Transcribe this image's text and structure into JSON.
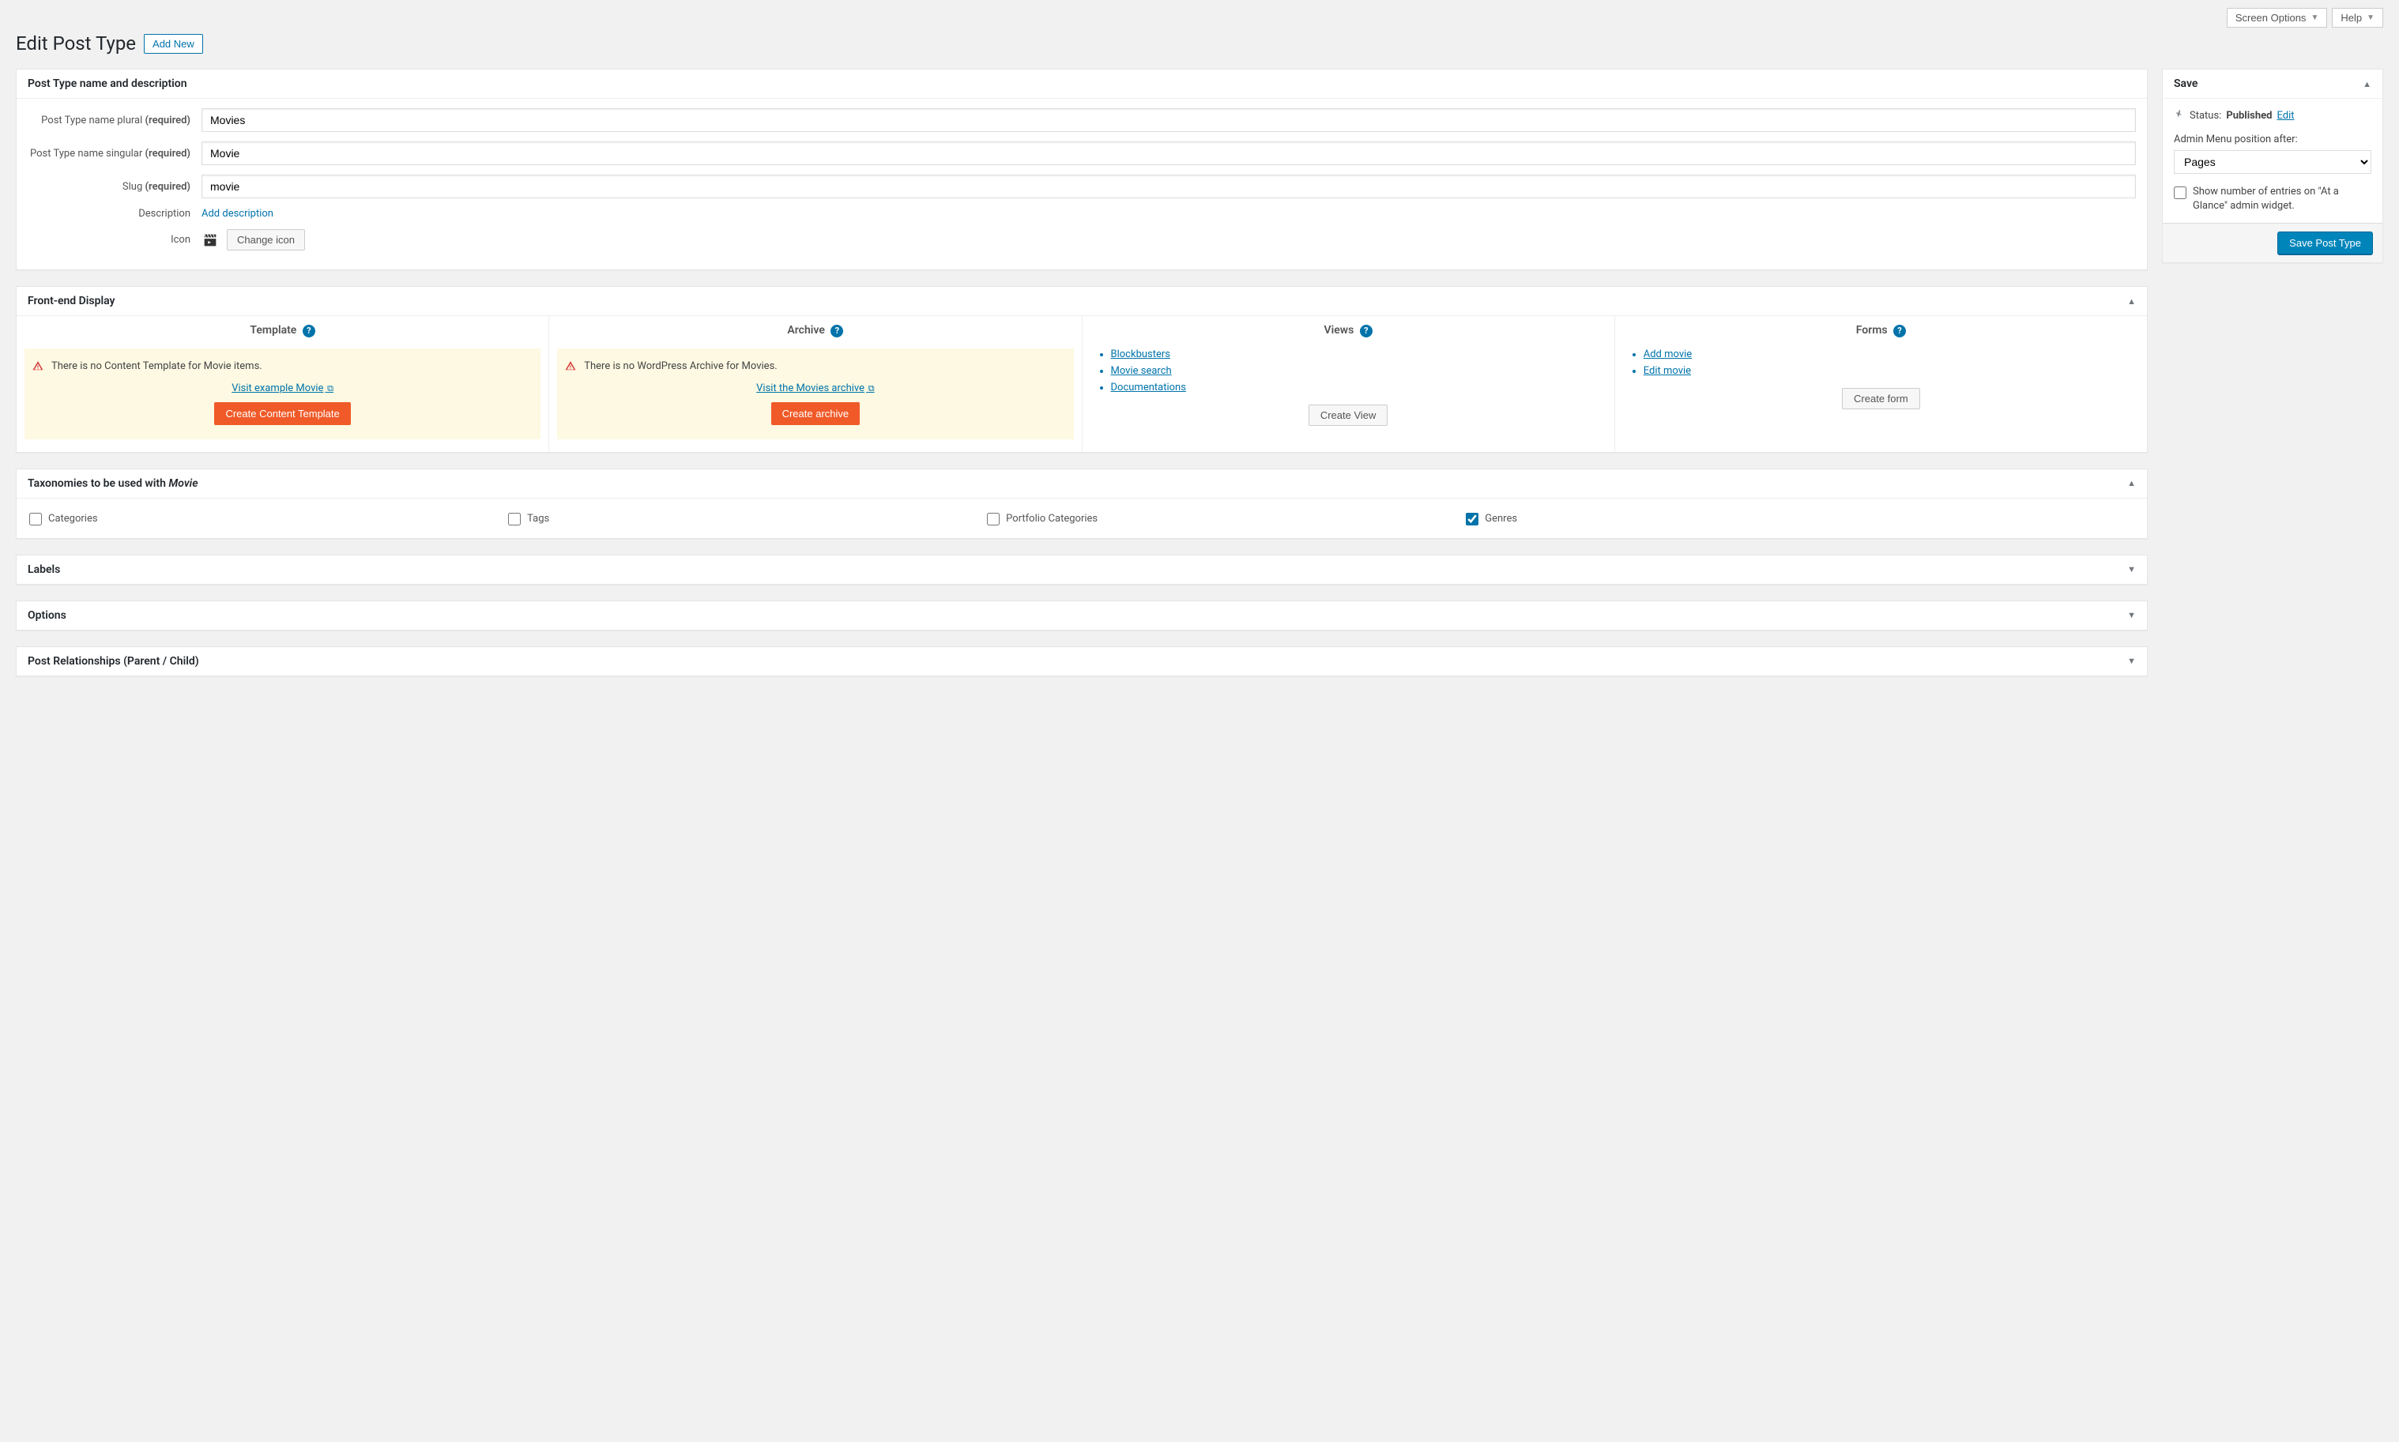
{
  "top_bar": {
    "screen_options": "Screen Options",
    "help": "Help"
  },
  "heading": {
    "title": "Edit Post Type",
    "add_new": "Add New"
  },
  "box_name": {
    "title": "Post Type name and description",
    "label_plural": "Post Type name plural",
    "label_singular": "Post Type name singular",
    "label_slug": "Slug",
    "label_required": "(required)",
    "label_description": "Description",
    "label_icon": "Icon",
    "value_plural": "Movies",
    "value_singular": "Movie",
    "value_slug": "movie",
    "add_description": "Add description",
    "change_icon": "Change icon"
  },
  "box_display": {
    "title": "Front-end Display",
    "col_template": "Template",
    "col_archive": "Archive",
    "col_views": "Views",
    "col_forms": "Forms",
    "template_warning": "There is no Content Template for Movie items.",
    "template_link": "Visit example Movie",
    "template_btn": "Create Content Template",
    "archive_warning": "There is no WordPress Archive for Movies.",
    "archive_link": "Visit the Movies archive",
    "archive_btn": "Create archive",
    "views": [
      "Blockbusters",
      "Movie search",
      "Documentations"
    ],
    "views_btn": "Create View",
    "forms": [
      "Add movie",
      "Edit movie"
    ],
    "forms_btn": "Create form"
  },
  "box_tax": {
    "title_prefix": "Taxonomies to be used with ",
    "title_em": "Movie",
    "items": [
      {
        "label": "Categories",
        "checked": false
      },
      {
        "label": "Tags",
        "checked": false
      },
      {
        "label": "Portfolio Categories",
        "checked": false
      },
      {
        "label": "Genres",
        "checked": true
      }
    ]
  },
  "box_labels": {
    "title": "Labels"
  },
  "box_options": {
    "title": "Options"
  },
  "box_relations": {
    "title": "Post Relationships (Parent / Child)"
  },
  "sidebar": {
    "save_title": "Save",
    "status_label": "Status:",
    "status_value": "Published",
    "status_edit": "Edit",
    "menu_pos_label": "Admin Menu position after:",
    "menu_pos_value": "Pages",
    "glance_label": "Show number of entries on \"At a Glance\" admin widget.",
    "save_btn": "Save Post Type"
  }
}
